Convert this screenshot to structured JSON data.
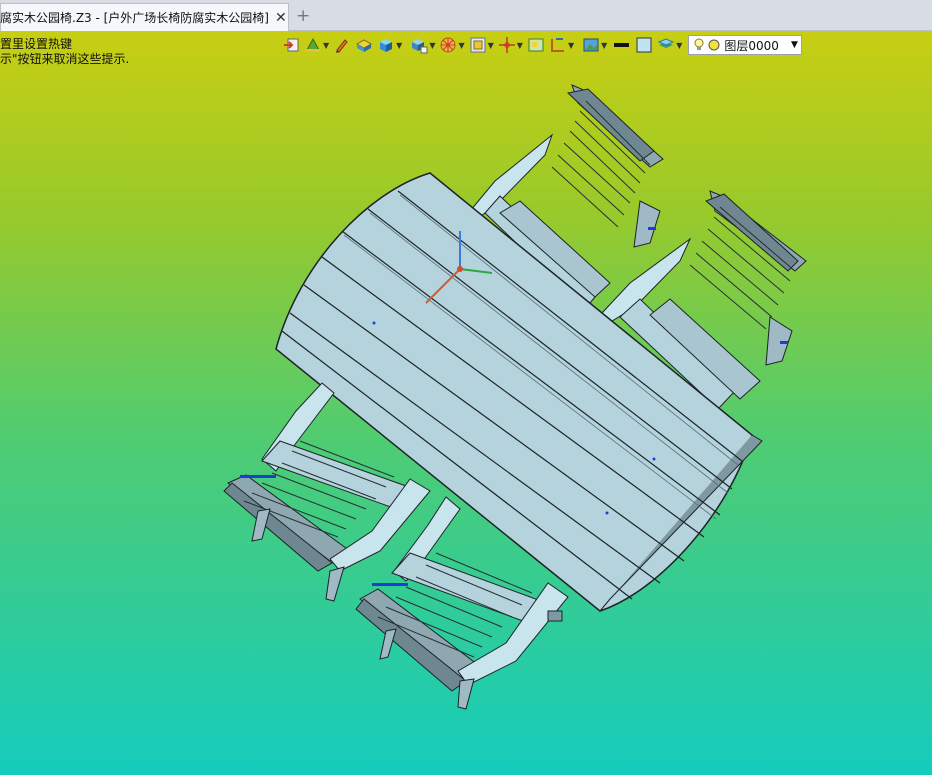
{
  "tab": {
    "title": "腐实木公园椅.Z3 - [户外广场长椅防腐实木公园椅]",
    "close": "✕",
    "add": "+"
  },
  "hints": {
    "line1": "置里设置热键",
    "line2": "示\"按钮来取消这些提示."
  },
  "toolbar": {
    "icons": [
      "import-icon",
      "views-icon",
      "pencil-icon",
      "render-shaded-icon",
      "solid-cube-icon",
      "display-mode-icon",
      "orbit-icon",
      "zoom-fit-icon",
      "pan-move-icon",
      "frame-icon",
      "dimension-icon",
      "image-icon",
      "line-color-icon",
      "fill-color-icon",
      "layer-stack-icon"
    ],
    "layer": {
      "name": "图层0000",
      "icons": [
        "bulb-icon",
        "layer-color-dot-icon"
      ]
    }
  },
  "colors": {
    "viewport_top": "#c8ce12",
    "viewport_bottom": "#14ccbd",
    "wood_surface": "#b5d3dd",
    "wood_dark": "#8fa7b0",
    "edge": "#1d2327"
  }
}
